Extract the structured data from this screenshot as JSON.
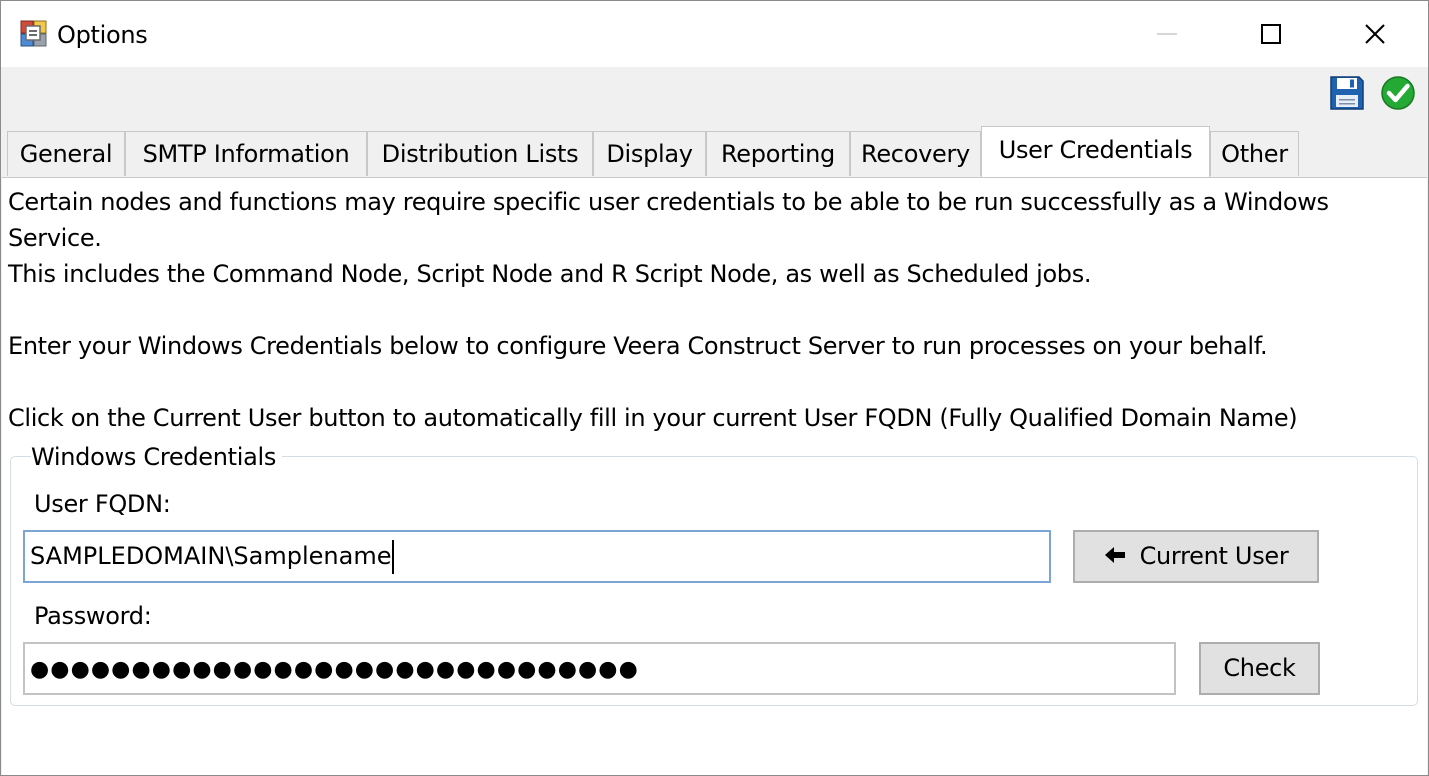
{
  "window": {
    "title": "Options"
  },
  "titlebar_buttons": {
    "minimize": "minimize-icon",
    "maximize": "maximize-icon",
    "close": "close-icon"
  },
  "toolbar": {
    "save_icon": "save-icon",
    "ok_icon": "checkmark-icon"
  },
  "tabs": [
    {
      "label": "General"
    },
    {
      "label": "SMTP Information"
    },
    {
      "label": "Distribution Lists"
    },
    {
      "label": "Display"
    },
    {
      "label": "Reporting"
    },
    {
      "label": "Recovery"
    },
    {
      "label": "User Credentials",
      "active": true
    },
    {
      "label": "Other"
    }
  ],
  "content": {
    "line1": "Certain nodes and functions may require specific user credentials to be able to be run successfully as a Windows",
    "line2": "Service.",
    "line3": "This includes the Command Node, Script Node and R Script Node, as well as Scheduled jobs.",
    "line4": "Enter your Windows Credentials below to configure Veera Construct Server to run processes on your behalf.",
    "line5": "Click on the Current User button to automatically fill in your current User FQDN (Fully Qualified Domain Name)"
  },
  "credentials": {
    "group_title": "Windows Credentials",
    "fqdn_label": "User FQDN:",
    "fqdn_value": "SAMPLEDOMAIN\\Samplename",
    "current_user_button": "Current User",
    "password_label": "Password:",
    "password_value": "●●●●●●●●●●●●●●●●●●●●●●●●●●●●●●",
    "check_button": "Check"
  },
  "colors": {
    "titlebar": "#ffffff",
    "background": "#f0f0f0",
    "focus_border": "#7aa6d6",
    "button_face": "#e1e1e1"
  }
}
